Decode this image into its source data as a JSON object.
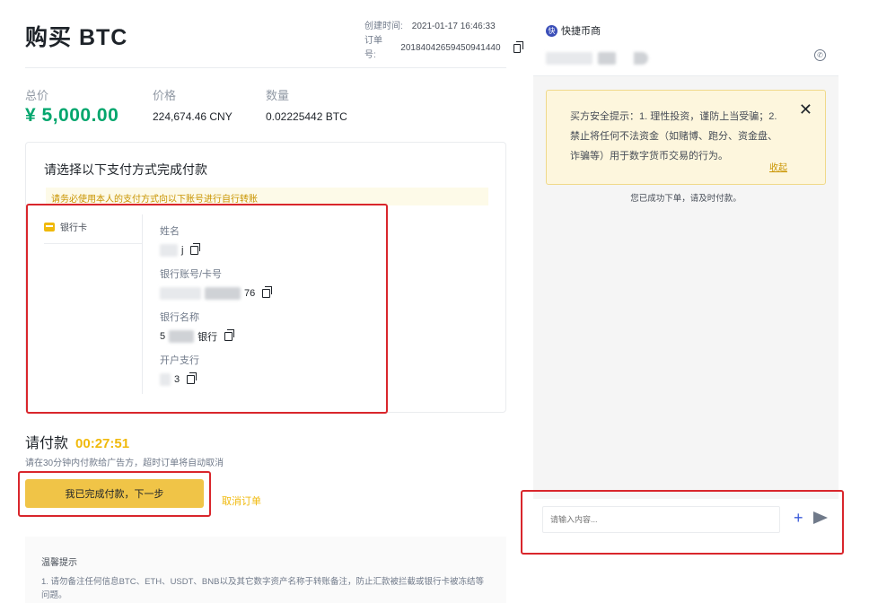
{
  "order": {
    "title": "购买 BTC",
    "created_label": "创建时间:",
    "created_value": "2021-01-17 16:46:33",
    "order_no_label": "订单号:",
    "order_no_value": "20184042659450941440"
  },
  "summary": {
    "total_label": "总价",
    "total_value": "¥ 5,000.00",
    "price_label": "价格",
    "price_value": "224,674.46 CNY",
    "qty_label": "数量",
    "qty_value": "0.02225442 BTC"
  },
  "payment": {
    "heading": "请选择以下支付方式完成付款",
    "warning": "请务必使用本人的支付方式向以下账号进行自行转账",
    "method_label": "银行卡",
    "fields": [
      {
        "label": "姓名",
        "value": "j"
      },
      {
        "label": "银行账号/卡号",
        "value": "76"
      },
      {
        "label": "银行名称",
        "value": "银行"
      },
      {
        "label": "开户支行",
        "value": "3"
      }
    ],
    "bank_prefix": "5"
  },
  "pay": {
    "label": "请付款",
    "timer": "00:27:51",
    "tip": "请在30分钟内付款给广告方，超时订单将自动取消",
    "done_button": "我已完成付款，下一步",
    "cancel_link": "取消订单"
  },
  "notice": {
    "title": "温馨提示",
    "body": "1. 请勿备注任何信息BTC、ETH、USDT、BNB以及其它数字资产名称于转账备注，防止汇款被拦截或银行卡被冻结等问题。"
  },
  "chat": {
    "merchant_name": "快捷币商",
    "merchant_avatar": "快",
    "safety_text": "买方安全提示：1. 理性投资，谨防上当受骗；2.禁止将任何不法资金（如赌博、跑分、资金盘、诈骗等）用于数字货币交易的行为。",
    "fold_label": "收起",
    "system_message": "您已成功下单，请及时付款。",
    "input_placeholder": "请输入内容..."
  },
  "colors": {
    "accent_yellow": "#f0b90b",
    "total_green": "#03a66d",
    "highlight_red": "#d9262c"
  }
}
